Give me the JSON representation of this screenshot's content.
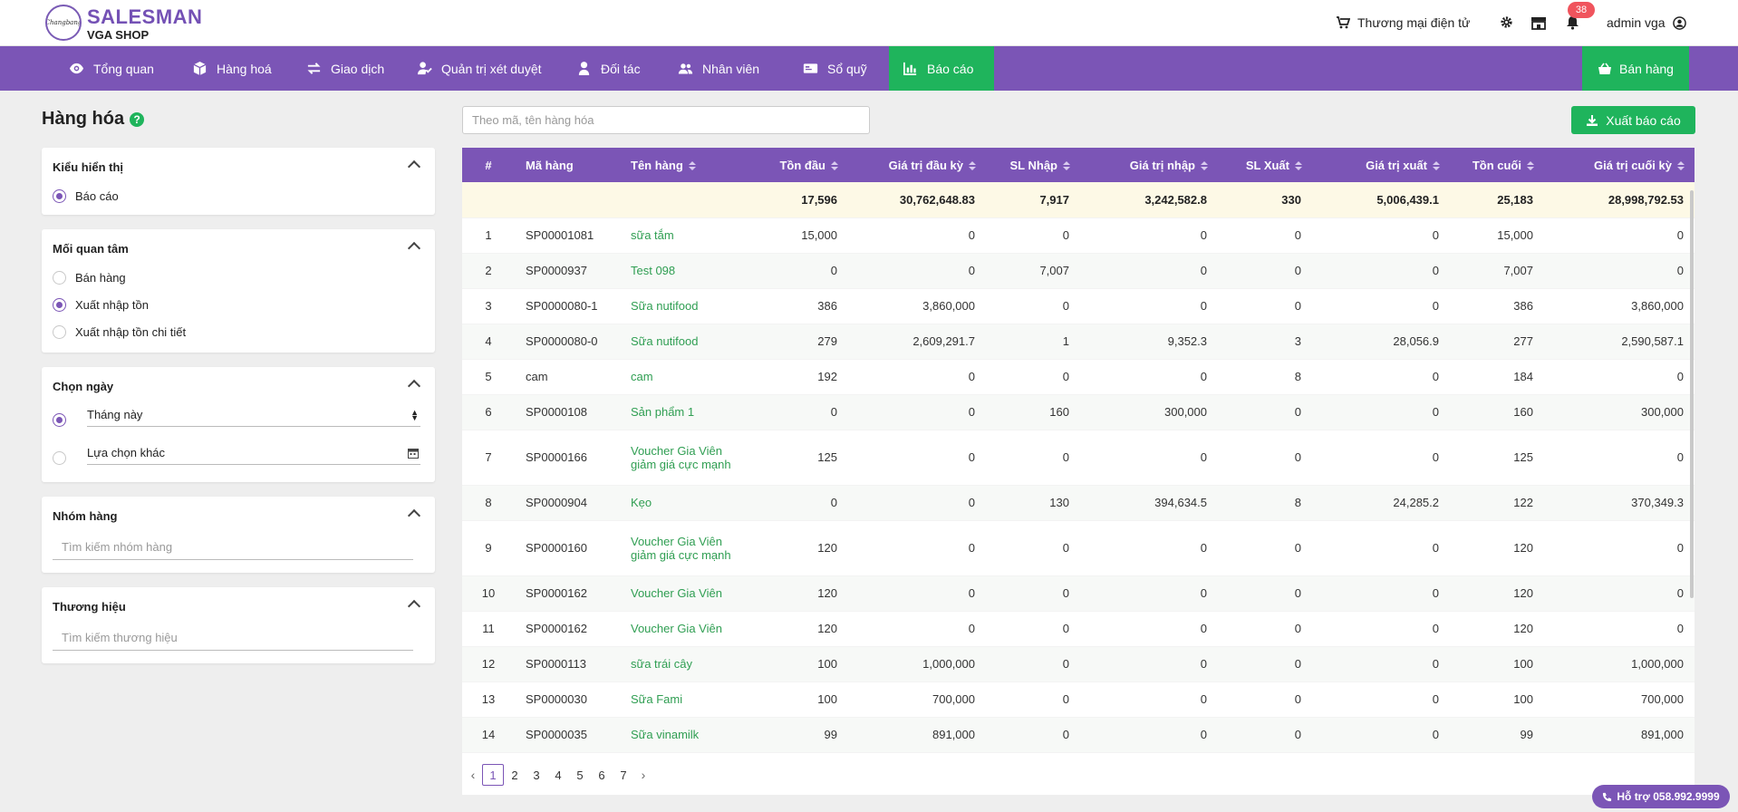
{
  "brand": {
    "logo_text": "Changbang",
    "name": "SALESMAN",
    "shop": "VGA SHOP"
  },
  "topbar": {
    "ecommerce_label": "Thương mại điện tử",
    "notification_count": "38",
    "user_label": "admin vga"
  },
  "nav": {
    "items": [
      {
        "label": "Tổng quan",
        "icon": "eye-icon"
      },
      {
        "label": "Hàng hoá",
        "icon": "box-icon"
      },
      {
        "label": "Giao dịch",
        "icon": "exchange-icon"
      },
      {
        "label": "Quản trị xét duyệt",
        "icon": "user-check-icon"
      },
      {
        "label": "Đối tác",
        "icon": "user-icon"
      },
      {
        "label": "Nhân viên",
        "icon": "users-icon"
      },
      {
        "label": "Sổ quỹ",
        "icon": "id-card-icon"
      },
      {
        "label": "Báo cáo",
        "icon": "chart-icon"
      }
    ],
    "sell_label": "Bán hàng"
  },
  "sidebar": {
    "title": "Hàng hóa",
    "display": {
      "title": "Kiểu hiển thị",
      "option": "Báo cáo"
    },
    "interest": {
      "title": "Mối quan tâm",
      "options": [
        "Bán hàng",
        "Xuất nhập tồn",
        "Xuất nhập tồn chi tiết"
      ]
    },
    "date": {
      "title": "Chọn ngày",
      "preset": "Tháng này",
      "custom": "Lựa chọn khác"
    },
    "group": {
      "title": "Nhóm hàng",
      "placeholder": "Tìm kiếm nhóm hàng"
    },
    "brand": {
      "title": "Thương hiệu",
      "placeholder": "Tìm kiếm thương hiệu"
    }
  },
  "search": {
    "placeholder": "Theo mã, tên hàng hóa"
  },
  "export_label": "Xuất báo cáo",
  "table": {
    "headers": [
      "#",
      "Mã hàng",
      "Tên hàng",
      "Tồn đầu",
      "Giá trị đầu kỳ",
      "SL Nhập",
      "Giá trị nhập",
      "SL Xuất",
      "Giá trị xuất",
      "Tồn cuối",
      "Giá trị cuối kỳ"
    ],
    "summary": [
      "",
      "",
      "",
      "17,596",
      "30,762,648.83",
      "7,917",
      "3,242,582.8",
      "330",
      "5,006,439.1",
      "25,183",
      "28,998,792.53"
    ],
    "rows": [
      [
        "1",
        "SP00001081",
        "sữa tắm",
        "15,000",
        "0",
        "0",
        "0",
        "0",
        "0",
        "15,000",
        "0"
      ],
      [
        "2",
        "SP0000937",
        "Test 098",
        "0",
        "0",
        "7,007",
        "0",
        "0",
        "0",
        "7,007",
        "0"
      ],
      [
        "3",
        "SP0000080-1",
        "Sữa nutifood",
        "386",
        "3,860,000",
        "0",
        "0",
        "0",
        "0",
        "386",
        "3,860,000"
      ],
      [
        "4",
        "SP0000080-0",
        "Sữa nutifood",
        "279",
        "2,609,291.7",
        "1",
        "9,352.3",
        "3",
        "28,056.9",
        "277",
        "2,590,587.1"
      ],
      [
        "5",
        "cam",
        "cam",
        "192",
        "0",
        "0",
        "0",
        "8",
        "0",
        "184",
        "0"
      ],
      [
        "6",
        "SP0000108",
        "Sản phẩm 1",
        "0",
        "0",
        "160",
        "300,000",
        "0",
        "0",
        "160",
        "300,000"
      ],
      [
        "7",
        "SP0000166",
        "Voucher Gia Viên giảm giá cực mạnh",
        "125",
        "0",
        "0",
        "0",
        "0",
        "0",
        "125",
        "0"
      ],
      [
        "8",
        "SP0000904",
        "Kẹo",
        "0",
        "0",
        "130",
        "394,634.5",
        "8",
        "24,285.2",
        "122",
        "370,349.3"
      ],
      [
        "9",
        "SP0000160",
        "Voucher Gia Viên giảm giá cực mạnh",
        "120",
        "0",
        "0",
        "0",
        "0",
        "0",
        "120",
        "0"
      ],
      [
        "10",
        "SP0000162",
        "Voucher Gia Viên",
        "120",
        "0",
        "0",
        "0",
        "0",
        "0",
        "120",
        "0"
      ],
      [
        "11",
        "SP0000162",
        "Voucher Gia Viên",
        "120",
        "0",
        "0",
        "0",
        "0",
        "0",
        "120",
        "0"
      ],
      [
        "12",
        "SP0000113",
        "sữa trái cây",
        "100",
        "1,000,000",
        "0",
        "0",
        "0",
        "0",
        "100",
        "1,000,000"
      ],
      [
        "13",
        "SP0000030",
        "Sữa Fami",
        "100",
        "700,000",
        "0",
        "0",
        "0",
        "0",
        "100",
        "700,000"
      ],
      [
        "14",
        "SP0000035",
        "Sữa vinamilk",
        "99",
        "891,000",
        "0",
        "0",
        "0",
        "0",
        "99",
        "891,000"
      ]
    ]
  },
  "pagination": {
    "pages": [
      "1",
      "2",
      "3",
      "4",
      "5",
      "6",
      "7"
    ],
    "current": "1"
  },
  "support_label": "Hỗ trợ 058.992.9999",
  "colors": {
    "primary": "#7b55b6",
    "accent": "#1fb45c",
    "link": "#2f9e52",
    "badge": "#f0545d"
  }
}
